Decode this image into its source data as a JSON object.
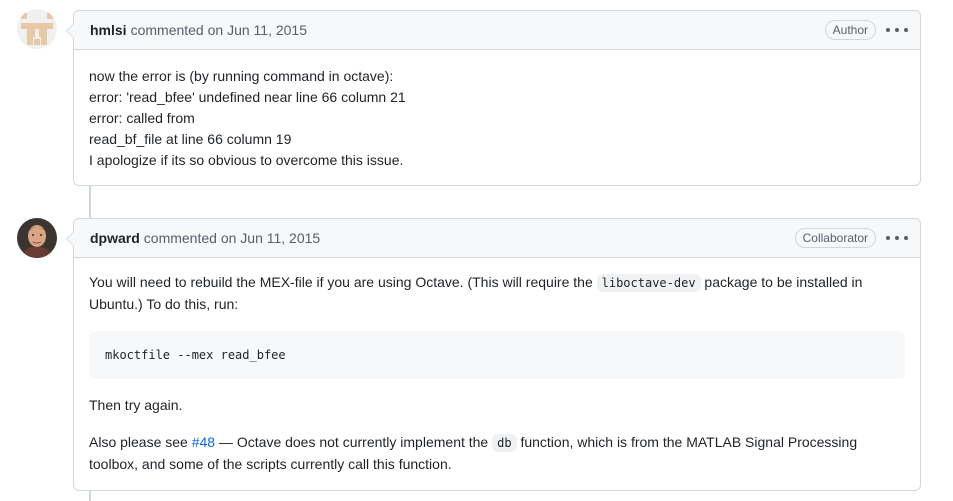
{
  "comments": [
    {
      "author": "hmlsi",
      "meta": "commented on Jun 11, 2015",
      "badge": "Author",
      "avatar_icon": "identicon",
      "body_lines": [
        "now the error is (by running command in octave):",
        "error: 'read_bfee' undefined near line 66 column 21",
        "error: called from",
        "read_bf_file at line 66 column 19",
        "I apologize if its so obvious to overcome this issue."
      ]
    },
    {
      "author": "dpward",
      "meta": "commented on Jun 11, 2015",
      "badge": "Collaborator",
      "avatar_icon": "user-photo",
      "para1_before": "You will need to rebuild the MEX-file if you are using Octave. (This will require the ",
      "para1_code": "liboctave-dev",
      "para1_after": " package to be installed in Ubuntu.) To do this, run:",
      "code_block": "mkoctfile --mex read_bfee",
      "para2": "Then try again.",
      "para3_before": "Also please see ",
      "para3_link": "#48",
      "para3_mid": " — Octave does not currently implement the ",
      "para3_code": "db",
      "para3_after": " function, which is from the MATLAB Signal Processing toolbox, and some of the scripts currently call this function."
    }
  ],
  "colors": {
    "border": "#d0d7de",
    "header_bg": "#f6f8fa",
    "link": "#0969da",
    "identicon": "#e8c9a7"
  }
}
